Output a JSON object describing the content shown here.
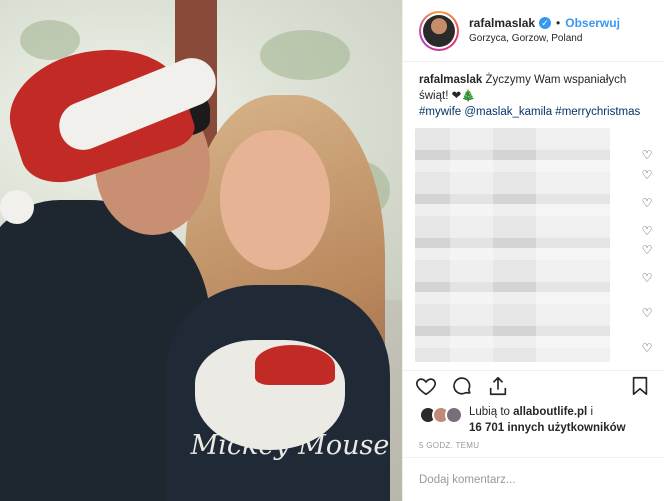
{
  "post": {
    "username": "rafalmaslak",
    "follow_label": "Obserwuj",
    "location": "Gorzyca, Gorzow, Poland",
    "separator": "•"
  },
  "caption": {
    "username": "rafalmaslak",
    "text": " Życzymy Wam wspaniałych świąt! ❤🎄",
    "tags": "#mywife @maslak_kamila #merrychristmas"
  },
  "photo": {
    "shirt_text": "Mickey Mouse"
  },
  "comments": {
    "heart_icon": "♡"
  },
  "likes": {
    "prefix": "Lubią to ",
    "first_user": "allaboutlife.pl",
    "suffix": " i",
    "count_text": "16 701 innych użytkowników"
  },
  "timestamp": "5 GODZ. TEMU",
  "comment_box": {
    "placeholder": "Dodaj komentarz..."
  },
  "colors": {
    "accent": "#3897f0",
    "tag": "#003569"
  }
}
